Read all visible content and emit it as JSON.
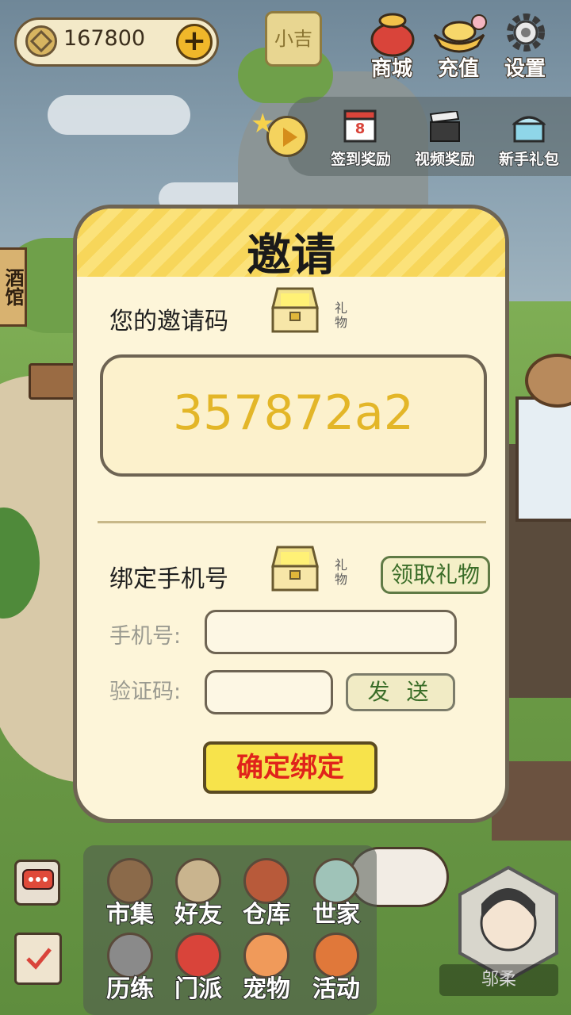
{
  "hud": {
    "coins": "167800",
    "luck_label": "小吉",
    "top_buttons": [
      {
        "label": "商城",
        "icon": "money-bag-icon"
      },
      {
        "label": "充值",
        "icon": "gold-ingot-icon"
      },
      {
        "label": "设置",
        "icon": "gear-icon"
      }
    ],
    "rewards": [
      {
        "label": "签到奖励",
        "icon": "calendar-icon",
        "calendar_day": "8"
      },
      {
        "label": "视频奖励",
        "icon": "clapperboard-icon"
      },
      {
        "label": "新手礼包",
        "icon": "treasure-chest-icon"
      }
    ],
    "side_sign": "酒馆"
  },
  "modal": {
    "title": "邀请",
    "invite_label": "您的邀请码",
    "gift_note": "礼物",
    "invite_code": "357872a2",
    "bind_label": "绑定手机号",
    "claim_button": "领取礼物",
    "phone_label": "手机号:",
    "phone_value": "",
    "code_label": "验证码:",
    "code_value": "",
    "send_button": "发 送",
    "confirm_button": "确定绑定"
  },
  "bottom_menu": [
    {
      "label": "市集",
      "icon": "shelf-icon"
    },
    {
      "label": "好友",
      "icon": "handshake-icon"
    },
    {
      "label": "仓库",
      "icon": "chest-icon"
    },
    {
      "label": "世家",
      "icon": "robe-icon"
    },
    {
      "label": "历练",
      "icon": "crossed-swords-icon"
    },
    {
      "label": "门派",
      "icon": "banner-icon"
    },
    {
      "label": "宠物",
      "icon": "paw-icon"
    },
    {
      "label": "活动",
      "icon": "lantern-icon"
    }
  ],
  "avatar_name": "邬柔",
  "colors": {
    "accent_yellow": "#f7e34b",
    "code_gold": "#e3b628",
    "confirm_red": "#e0231b",
    "button_green": "#3a6d28"
  }
}
